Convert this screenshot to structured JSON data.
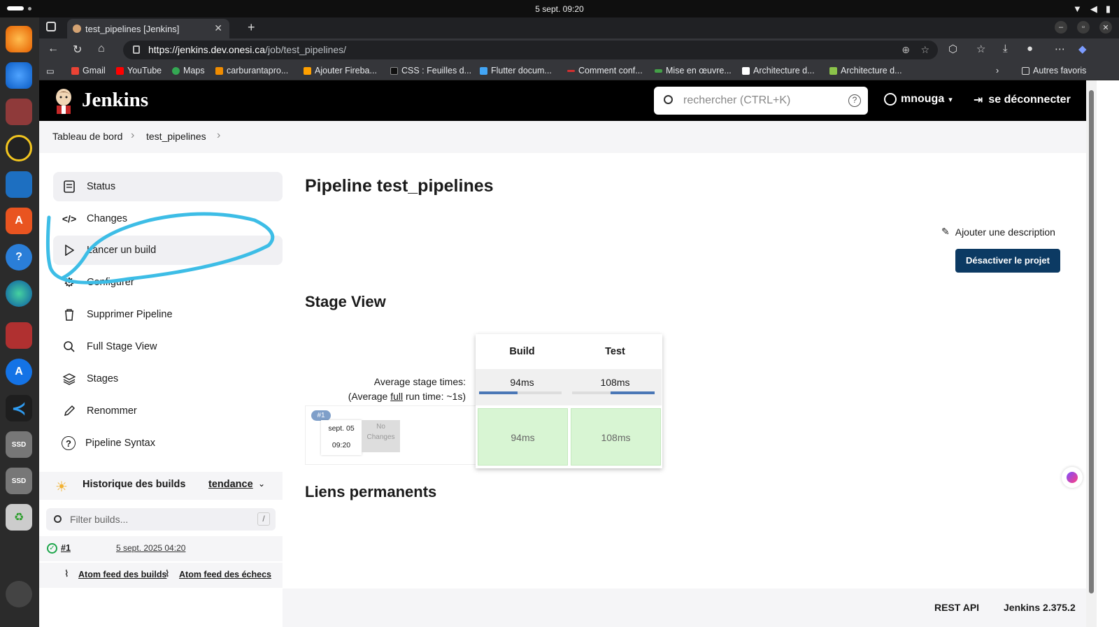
{
  "system": {
    "clock": "5 sept.  09:20"
  },
  "browser": {
    "tab_title": "test_pipelines [Jenkins]",
    "url_host": "https://jenkins.dev.onesi.ca",
    "url_path": "/job/test_pipelines/",
    "bookmarks": [
      "Gmail",
      "YouTube",
      "Maps",
      "carburantapro...",
      "Ajouter Fireba...",
      "CSS : Feuilles d...",
      "Flutter docum...",
      "Comment conf...",
      "Mise en œuvre...",
      "Architecture d...",
      "Architecture d..."
    ],
    "other_bookmarks": "Autres favoris"
  },
  "jenkins": {
    "brand": "Jenkins",
    "search_placeholder": "rechercher (CTRL+K)",
    "user": "mnouga",
    "logout": "se déconnecter",
    "breadcrumb": [
      "Tableau de bord",
      "test_pipelines"
    ],
    "sidebar": [
      {
        "label": "Status"
      },
      {
        "label": "Changes"
      },
      {
        "label": "Lancer un build"
      },
      {
        "label": "Configurer"
      },
      {
        "label": "Supprimer Pipeline"
      },
      {
        "label": "Full Stage View"
      },
      {
        "label": "Stages"
      },
      {
        "label": "Renommer"
      },
      {
        "label": "Pipeline Syntax"
      }
    ],
    "history": {
      "title": "Historique des builds",
      "trend": "tendance",
      "filter_placeholder": "Filter builds...",
      "filter_key": "/",
      "builds": [
        {
          "number": "#1",
          "date": "5 sept. 2025 04:20"
        }
      ],
      "feed_all": "Atom feed des builds",
      "feed_failures": "Atom feed des échecs"
    },
    "main": {
      "title": "Pipeline test_pipelines",
      "add_description": "Ajouter une description",
      "disable_button": "Désactiver le projet",
      "stage_view_title": "Stage View",
      "avg_label_1": "Average stage times:",
      "avg_label_2_pre": "(Average ",
      "avg_label_2_full": "full",
      "avg_label_2_post": " run time: ~1s)",
      "stages": [
        {
          "name": "Build",
          "avg": "94ms",
          "run": "94ms",
          "avg_fraction": 0.47
        },
        {
          "name": "Test",
          "avg": "108ms",
          "run": "108ms",
          "avg_fraction": 0.53
        }
      ],
      "run": {
        "badge": "#1",
        "date": "sept. 05",
        "time": "09:20",
        "changes": "No Changes"
      },
      "permalinks_title": "Liens permanents"
    },
    "footer": {
      "rest_api": "REST API",
      "version": "Jenkins 2.375.2"
    }
  },
  "colors": {
    "jenkins_header": "#000000",
    "primary_button": "#0c3a63",
    "stage_success": "#d8f5d3",
    "annotation": "#3dbde6"
  }
}
